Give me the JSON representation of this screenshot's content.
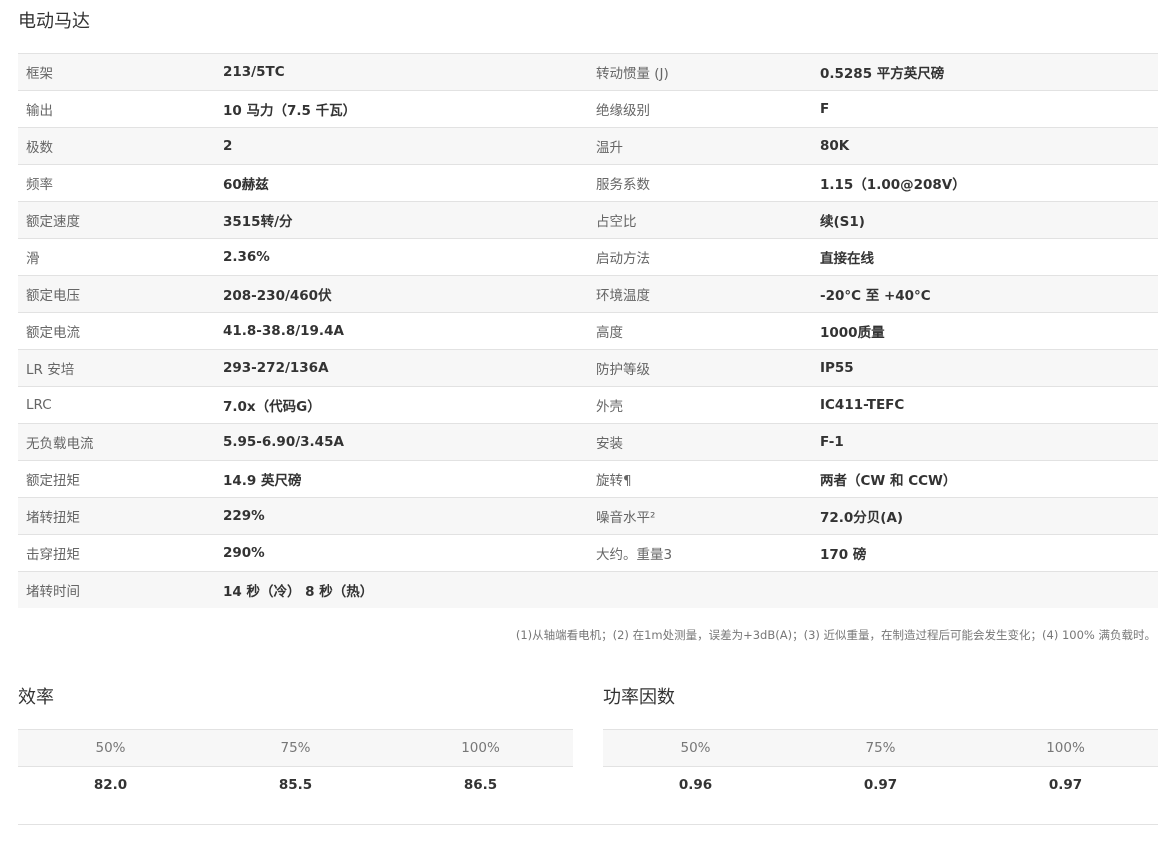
{
  "motor": {
    "title": "电动马达",
    "rows": [
      {
        "l1": "框架",
        "v1": "213/5TC",
        "l2": "转动惯量 (J)",
        "v2": "0.5285 平方英尺磅"
      },
      {
        "l1": "输出",
        "v1": "10 马力（7.5 千瓦）",
        "l2": "绝缘级别",
        "v2": "F"
      },
      {
        "l1": "极数",
        "v1": "2",
        "l2": "温升",
        "v2": "80K"
      },
      {
        "l1": "频率",
        "v1": "60赫兹",
        "l2": "服务系数",
        "v2": "1.15（1.00@208V）"
      },
      {
        "l1": "额定速度",
        "v1": "3515转/分",
        "l2": "占空比",
        "v2": "续(S1)"
      },
      {
        "l1": "滑",
        "v1": "2.36%",
        "l2": "启动方法",
        "v2": "直接在线"
      },
      {
        "l1": "额定电压",
        "v1": "208-230/460伏",
        "l2": "环境温度",
        "v2": "-20°C 至 +40°C"
      },
      {
        "l1": "额定电流",
        "v1": "41.8-38.8/19.4A",
        "l2": "高度",
        "v2": "1000质量"
      },
      {
        "l1": "LR 安培",
        "v1": "293-272/136A",
        "l2": "防护等级",
        "v2": "IP55"
      },
      {
        "l1": "LRC",
        "v1": "7.0x（代码G）",
        "l2": "外壳",
        "v2": "IC411-TEFC"
      },
      {
        "l1": "无负载电流",
        "v1": "5.95-6.90/3.45A",
        "l2": "安装",
        "v2": "F-1"
      },
      {
        "l1": "额定扭矩",
        "v1": "14.9 英尺磅",
        "l2": "旋转¶",
        "v2": "两者（CW 和 CCW）"
      },
      {
        "l1": "堵转扭矩",
        "v1": "229%",
        "l2": "噪音水平²",
        "v2": "72.0分贝(A)"
      },
      {
        "l1": "击穿扭矩",
        "v1": "290%",
        "l2": "大约。重量3",
        "v2": "170 磅"
      },
      {
        "l1": "堵转时间",
        "v1": "14 秒（冷） 8 秒（热）",
        "l2": "",
        "v2": ""
      }
    ],
    "footnote": "(1)从轴端看电机；(2) 在1m处测量，误差为+3dB(A)；(3) 近似重量，在制造过程后可能会发生变化；(4) 100% 满负载时。"
  },
  "efficiency": {
    "title": "效率",
    "headers": [
      "50%",
      "75%",
      "100%"
    ],
    "values": [
      "82.0",
      "85.5",
      "86.5"
    ]
  },
  "power_factor": {
    "title": "功率因数",
    "headers": [
      "50%",
      "75%",
      "100%"
    ],
    "values": [
      "0.96",
      "0.97",
      "0.97"
    ]
  }
}
